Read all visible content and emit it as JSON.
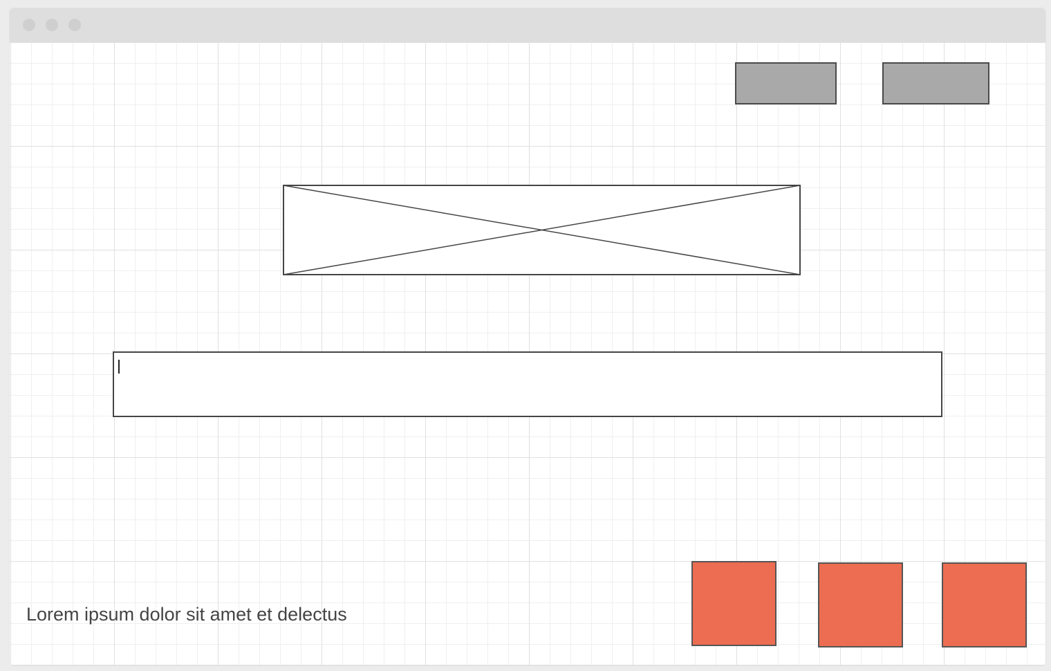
{
  "window": {
    "controls": [
      "close-dot",
      "minimize-dot",
      "zoom-dot"
    ]
  },
  "header": {
    "button_1_label": "",
    "button_2_label": ""
  },
  "main": {
    "image_placeholder": "image-placeholder-icon",
    "text_input": {
      "value": "",
      "placeholder": ""
    },
    "footer_text": "Lorem ipsum dolor sit amet et delectus"
  },
  "actions": {
    "tile_1_label": "",
    "tile_2_label": "",
    "tile_3_label": ""
  },
  "colors": {
    "titlebar": "#dedede",
    "gray_button": "#a9a9a9",
    "accent_tile": "#ec6d51",
    "border": "#444444"
  }
}
